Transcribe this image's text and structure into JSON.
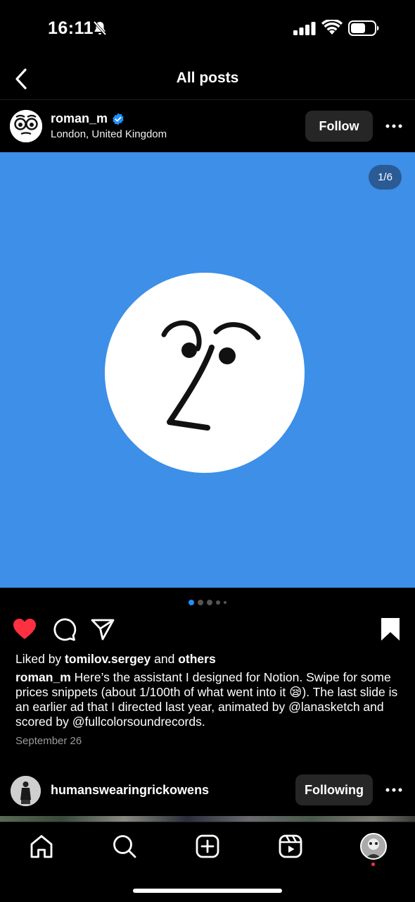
{
  "status_bar": {
    "time": "16:11"
  },
  "header": {
    "title": "All posts"
  },
  "post": {
    "username": "roman_m",
    "location": "London, United Kingdom",
    "follow_label": "Follow",
    "counter": "1/6",
    "liked_by_prefix": "Liked by ",
    "liked_by_user": "tomilov.sergey",
    "liked_by_mid": " and ",
    "liked_by_others": "others",
    "caption_user": "roman_m",
    "caption_text": " Here’s the assistant I designed for Notion. Swipe for some prices snippets (about 1/100th of what went into it 😪). The last slide is an earlier ad that I directed last year, animated by @lanasketch and scored by @fullcolorsoundrecords.",
    "date": "September 26"
  },
  "next_post": {
    "username": "humanswearingrickowens",
    "following_label": "Following"
  },
  "colors": {
    "media_bg": "#3d8fe8",
    "like_red": "#ff3040",
    "verified_blue": "#1f8fff",
    "active_dot": "#1f8fff"
  },
  "icons": [
    "bell-off-icon",
    "signal-icon",
    "wifi-icon",
    "battery-icon",
    "back-arrow-icon",
    "verified-badge-icon",
    "more-icon",
    "heart-icon",
    "comment-icon",
    "share-icon",
    "bookmark-icon",
    "home-icon",
    "search-icon",
    "create-icon",
    "reels-icon"
  ]
}
